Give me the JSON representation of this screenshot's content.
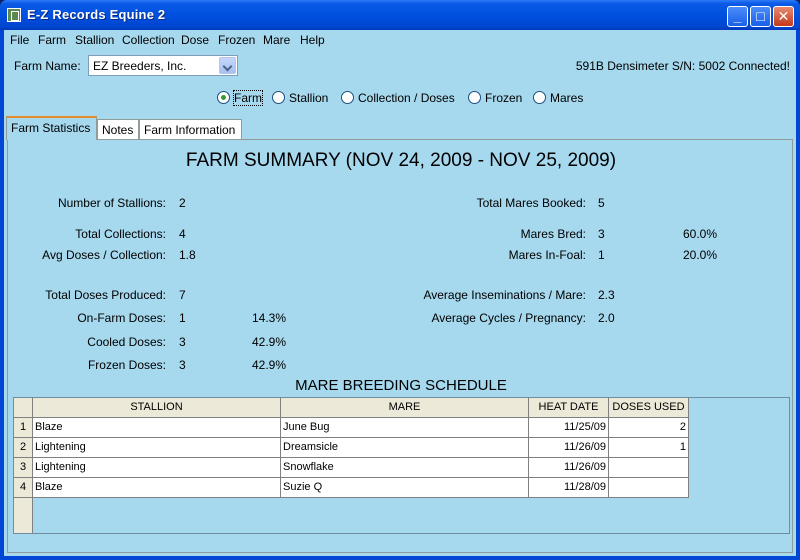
{
  "window": {
    "title": "E-Z Records Equine 2",
    "minimize": "_",
    "maximize": "□",
    "close": "✕"
  },
  "menu": [
    "File",
    "Farm",
    "Stallion",
    "Collection",
    "Dose",
    "Frozen",
    "Mare",
    "Help"
  ],
  "farm": {
    "label": "Farm Name:",
    "selected": "EZ Breeders, Inc."
  },
  "status": "591B Densimeter S/N: 5002 Connected!",
  "view_options": [
    {
      "label": "Farm",
      "selected": true
    },
    {
      "label": "Stallion",
      "selected": false
    },
    {
      "label": "Collection / Doses",
      "selected": false
    },
    {
      "label": "Frozen",
      "selected": false
    },
    {
      "label": "Mares",
      "selected": false
    }
  ],
  "tabs": [
    {
      "label": "Farm Statistics",
      "active": true
    },
    {
      "label": "Notes",
      "active": false
    },
    {
      "label": "Farm Information",
      "active": false
    }
  ],
  "summary": {
    "title": "FARM SUMMARY (NOV 24, 2009  -  NOV 25, 2009)",
    "left": [
      {
        "label": "Number of Stallions:",
        "value": "2",
        "pct": ""
      },
      {
        "label": "Total Collections:",
        "value": "4",
        "pct": ""
      },
      {
        "label": "Avg Doses / Collection:",
        "value": "1.8",
        "pct": ""
      },
      {
        "label": "Total Doses Produced:",
        "value": "7",
        "pct": ""
      },
      {
        "label": "On-Farm Doses:",
        "value": "1",
        "pct": "14.3%"
      },
      {
        "label": "Cooled Doses:",
        "value": "3",
        "pct": "42.9%"
      },
      {
        "label": "Frozen Doses:",
        "value": "3",
        "pct": "42.9%"
      }
    ],
    "right": [
      {
        "label": "Total Mares Booked:",
        "value": "5",
        "pct": ""
      },
      {
        "label": "Mares Bred:",
        "value": "3",
        "pct": "60.0%"
      },
      {
        "label": "Mares In-Foal:",
        "value": "1",
        "pct": "20.0%"
      },
      {
        "label": "Average Inseminations / Mare:",
        "value": "2.3",
        "pct": ""
      },
      {
        "label": "Average Cycles / Pregnancy:",
        "value": "2.0",
        "pct": ""
      }
    ]
  },
  "schedule": {
    "title": "MARE BREEDING SCHEDULE",
    "columns": [
      "STALLION",
      "MARE",
      "HEAT DATE",
      "DOSES USED"
    ],
    "rows": [
      {
        "num": "1",
        "stallion": "Blaze",
        "mare": "June Bug",
        "heat_date": "11/25/09",
        "doses_used": "2"
      },
      {
        "num": "2",
        "stallion": "Lightening",
        "mare": "Dreamsicle",
        "heat_date": "11/26/09",
        "doses_used": "1"
      },
      {
        "num": "3",
        "stallion": "Lightening",
        "mare": "Snowflake",
        "heat_date": "11/26/09",
        "doses_used": ""
      },
      {
        "num": "4",
        "stallion": "Blaze",
        "mare": "Suzie Q",
        "heat_date": "11/28/09",
        "doses_used": ""
      }
    ]
  }
}
